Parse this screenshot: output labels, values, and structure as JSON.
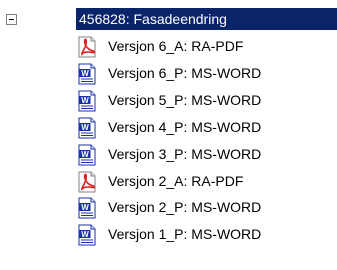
{
  "tree": {
    "root": {
      "label": "456828: Fasadeendring",
      "expanded": true
    },
    "items": [
      {
        "label": "Versjon 6_A: RA-PDF",
        "icon": "pdf-icon"
      },
      {
        "label": "Versjon 6_P: MS-WORD",
        "icon": "word-icon"
      },
      {
        "label": "Versjon 5_P: MS-WORD",
        "icon": "word-icon"
      },
      {
        "label": "Versjon 4_P: MS-WORD",
        "icon": "word-icon"
      },
      {
        "label": "Versjon 3_P: MS-WORD",
        "icon": "word-icon"
      },
      {
        "label": "Versjon 2_A: RA-PDF",
        "icon": "pdf-icon"
      },
      {
        "label": "Versjon 2_P: MS-WORD",
        "icon": "word-icon"
      },
      {
        "label": "Versjon 1_P: MS-WORD",
        "icon": "word-icon"
      }
    ]
  },
  "colors": {
    "selection": "#0a246a",
    "pdf": "#e02020",
    "word": "#1a2fa8"
  }
}
